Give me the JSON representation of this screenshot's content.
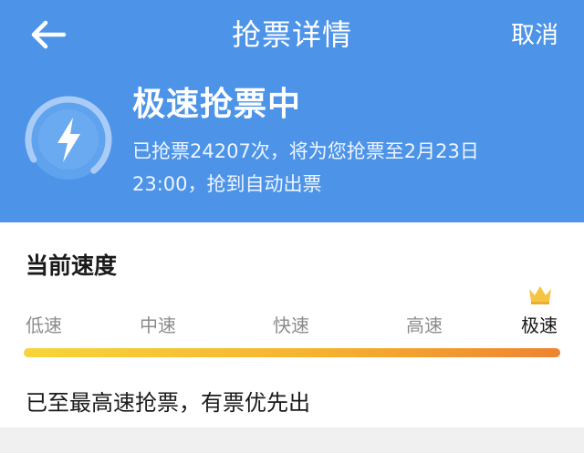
{
  "nav": {
    "title": "抢票详情",
    "cancel_label": "取消",
    "back_icon": "arrow-left-icon"
  },
  "status": {
    "icon": "lightning-icon",
    "title": "极速抢票中",
    "description_line1": "已抢票24207次，将为您抢票至2月23日",
    "description_line2": "23:00，抢到自动出票"
  },
  "speed": {
    "section_title": "当前速度",
    "levels": [
      "低速",
      "中速",
      "快速",
      "高速",
      "极速"
    ],
    "current_level": "极速",
    "current_level_index": 4,
    "level_fraction": 1.0,
    "crown_icon": "crown-icon",
    "note": "已至最高速抢票，有票优先出"
  },
  "colors": {
    "header_bg": "#4d94e8",
    "bar_start": "#f7d53a",
    "bar_end": "#ee8430",
    "crown": "#f5c443"
  }
}
